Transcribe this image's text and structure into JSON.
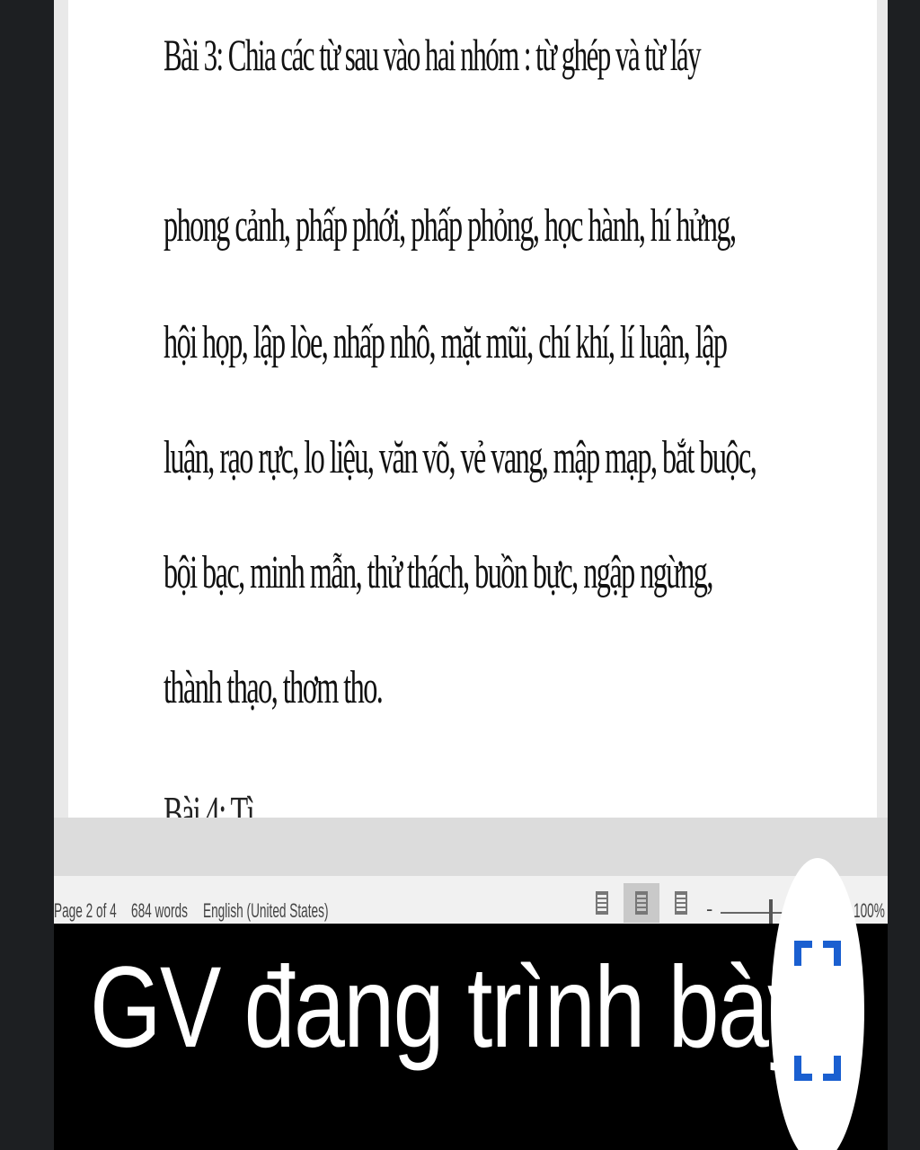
{
  "document": {
    "title": "Bài 3: Chia các từ sau vào hai nhóm : từ ghép và từ láy",
    "lines": [
      "phong cảnh, phấp phới, phấp phỏng, học hành, hí hửng,",
      "hội họp, lập lòe, nhấp nhô, mặt mũi, chí khí, lí luận, lập",
      "luận, rạo rực, lo liệu, văn võ, vẻ vang, mập mạp, bắt buộc,",
      "bội bạc, minh mẫn, thử thách, buồn bực, ngập ngừng,",
      "thành thạo, thơm tho."
    ],
    "next_line_partial": "Bài 4: Tì"
  },
  "statusbar": {
    "page": "Page 2 of 4",
    "words": "684 words",
    "language": "English (United States)",
    "zoom_label": "100%",
    "zoom_minus": "-"
  },
  "caption": {
    "text": "GV đang trình bày"
  },
  "icons": {
    "fullscreen": "fullscreen-icon",
    "view_read": "read-mode-icon",
    "view_print": "print-layout-icon",
    "view_web": "web-layout-icon"
  },
  "colors": {
    "fullscreen_icon": "#1a5fd0",
    "caption_bg": "#000000",
    "caption_text": "#ffffff"
  }
}
